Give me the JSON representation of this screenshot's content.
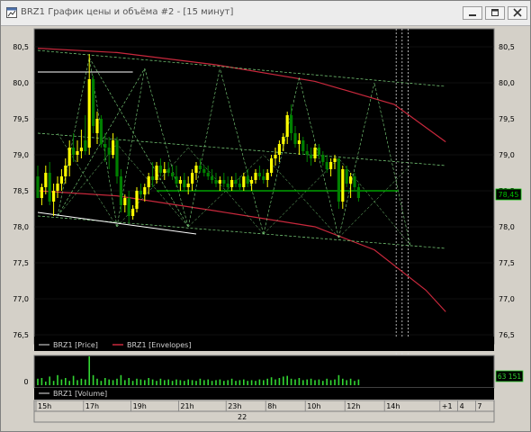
{
  "window": {
    "title": "BRZ1 График цены и объёма #2 - [15 минут]",
    "title_icon": "chart-window-icon",
    "buttons": [
      "minimize-icon",
      "maximize-icon",
      "close-icon"
    ]
  },
  "colors": {
    "background": "#000000",
    "frame": "#d4d0c8",
    "bull_candle": "#ffff00",
    "bear_candle": "#008000",
    "envelope": "#c8283c",
    "channel_lines": "#7fd87f",
    "support_line": "#00c000",
    "annotation_lines": "#ffffff",
    "volume_bars": "#33d633",
    "text": "#000000"
  },
  "chart_data": [
    {
      "type": "line",
      "name": "price",
      "chart_type": "candlestick",
      "ylim": [
        76.5,
        80.6
      ],
      "y_ticks": [
        "80,5",
        "80,0",
        "79,5",
        "79,0",
        "78,5",
        "78,0",
        "77,5",
        "77,0",
        "76,5"
      ],
      "last_price_label": "78,45",
      "legend": [
        "BRZ1 [Price]",
        "BRZ1 [Envelopes]"
      ],
      "candles": [
        [
          78.7,
          78.85,
          78.4,
          78.4
        ],
        [
          78.4,
          78.6,
          78.3,
          78.55
        ],
        [
          78.55,
          78.85,
          78.45,
          78.75
        ],
        [
          78.75,
          78.9,
          78.3,
          78.35
        ],
        [
          78.35,
          78.6,
          78.15,
          78.5
        ],
        [
          78.5,
          78.7,
          78.4,
          78.6
        ],
        [
          78.6,
          78.8,
          78.5,
          78.7
        ],
        [
          78.7,
          78.95,
          78.6,
          78.85
        ],
        [
          78.85,
          79.2,
          78.7,
          79.1
        ],
        [
          79.1,
          79.3,
          78.9,
          79.0
        ],
        [
          79.0,
          79.2,
          78.9,
          79.05
        ],
        [
          79.05,
          79.35,
          78.95,
          79.1
        ],
        [
          79.2,
          79.55,
          79.0,
          79.05
        ],
        [
          79.1,
          80.4,
          79.0,
          80.05
        ],
        [
          80.05,
          80.1,
          79.3,
          79.4
        ],
        [
          79.3,
          79.6,
          79.15,
          79.5
        ],
        [
          79.5,
          79.55,
          79.1,
          79.15
        ],
        [
          79.15,
          79.3,
          78.9,
          79.1
        ],
        [
          79.1,
          79.25,
          78.8,
          79.0
        ],
        [
          79.0,
          79.3,
          78.95,
          79.2
        ],
        [
          79.2,
          79.25,
          78.6,
          78.7
        ],
        [
          78.7,
          78.8,
          78.2,
          78.3
        ],
        [
          78.3,
          78.45,
          78.2,
          78.4
        ],
        [
          78.4,
          78.5,
          78.05,
          78.15
        ],
        [
          78.15,
          78.3,
          78.1,
          78.25
        ],
        [
          78.25,
          78.55,
          78.2,
          78.5
        ],
        [
          78.5,
          78.6,
          78.4,
          78.45
        ],
        [
          78.45,
          78.6,
          78.35,
          78.55
        ],
        [
          78.55,
          78.75,
          78.45,
          78.7
        ],
        [
          78.7,
          78.9,
          78.55,
          78.65
        ],
        [
          78.65,
          78.9,
          78.6,
          78.85
        ],
        [
          78.85,
          78.95,
          78.7,
          78.75
        ],
        [
          78.75,
          78.9,
          78.65,
          78.8
        ],
        [
          78.8,
          78.9,
          78.7,
          78.75
        ],
        [
          78.75,
          78.85,
          78.65,
          78.7
        ],
        [
          78.7,
          78.85,
          78.55,
          78.6
        ],
        [
          78.6,
          78.7,
          78.5,
          78.65
        ],
        [
          78.65,
          78.75,
          78.5,
          78.55
        ],
        [
          78.55,
          78.7,
          78.45,
          78.6
        ],
        [
          78.6,
          78.8,
          78.5,
          78.75
        ],
        [
          78.75,
          78.9,
          78.65,
          78.85
        ],
        [
          78.85,
          78.95,
          78.75,
          78.8
        ],
        [
          78.8,
          78.85,
          78.7,
          78.75
        ],
        [
          78.75,
          78.85,
          78.65,
          78.7
        ],
        [
          78.7,
          78.8,
          78.6,
          78.65
        ],
        [
          78.65,
          78.75,
          78.55,
          78.6
        ],
        [
          78.6,
          78.7,
          78.5,
          78.65
        ],
        [
          78.65,
          78.75,
          78.55,
          78.6
        ],
        [
          78.6,
          78.7,
          78.5,
          78.55
        ],
        [
          78.55,
          78.7,
          78.5,
          78.65
        ],
        [
          78.65,
          78.75,
          78.55,
          78.6
        ],
        [
          78.6,
          78.7,
          78.5,
          78.55
        ],
        [
          78.55,
          78.75,
          78.5,
          78.7
        ],
        [
          78.7,
          78.8,
          78.55,
          78.6
        ],
        [
          78.6,
          78.7,
          78.5,
          78.65
        ],
        [
          78.65,
          78.8,
          78.6,
          78.75
        ],
        [
          78.75,
          78.85,
          78.65,
          78.7
        ],
        [
          78.7,
          78.8,
          78.6,
          78.65
        ],
        [
          78.65,
          78.8,
          78.55,
          78.75
        ],
        [
          78.75,
          79.0,
          78.7,
          78.95
        ],
        [
          78.95,
          79.1,
          78.85,
          79.0
        ],
        [
          79.0,
          79.2,
          78.9,
          79.15
        ],
        [
          79.15,
          79.3,
          79.05,
          79.25
        ],
        [
          79.25,
          79.6,
          79.15,
          79.55
        ],
        [
          79.55,
          79.7,
          79.2,
          79.3
        ],
        [
          79.3,
          79.4,
          79.1,
          79.15
        ],
        [
          79.15,
          79.3,
          79.0,
          79.2
        ],
        [
          79.2,
          79.25,
          79.0,
          79.05
        ],
        [
          79.05,
          79.15,
          78.9,
          79.0
        ],
        [
          79.0,
          79.1,
          78.85,
          78.95
        ],
        [
          78.95,
          79.15,
          78.9,
          79.1
        ],
        [
          79.1,
          79.15,
          78.95,
          79.0
        ],
        [
          79.0,
          79.05,
          78.85,
          78.9
        ],
        [
          78.9,
          79.0,
          78.75,
          78.8
        ],
        [
          78.8,
          78.95,
          78.7,
          78.9
        ],
        [
          78.9,
          79.0,
          78.8,
          78.95
        ],
        [
          78.95,
          78.9,
          78.25,
          78.35
        ],
        [
          78.35,
          78.85,
          78.25,
          78.8
        ],
        [
          78.8,
          78.85,
          78.55,
          78.6
        ],
        [
          78.6,
          78.75,
          78.4,
          78.7
        ],
        [
          78.7,
          78.75,
          78.5,
          78.55
        ],
        [
          78.55,
          78.6,
          78.35,
          78.4
        ]
      ],
      "envelope_upper": [
        [
          0,
          80.48
        ],
        [
          20,
          80.42
        ],
        [
          45,
          80.25
        ],
        [
          70,
          80.02
        ],
        [
          90,
          79.7
        ],
        [
          103,
          79.18
        ]
      ],
      "envelope_lower": [
        [
          0,
          78.5
        ],
        [
          20,
          78.43
        ],
        [
          45,
          78.22
        ],
        [
          70,
          78.0
        ],
        [
          85,
          77.68
        ],
        [
          98,
          77.12
        ],
        [
          103,
          76.82
        ]
      ],
      "support_level": 78.5,
      "channel_upper": [
        [
          0,
          80.45
        ],
        [
          103,
          79.95
        ]
      ],
      "channel_mid": [
        [
          0,
          79.3
        ],
        [
          103,
          78.85
        ]
      ],
      "channel_lower": [
        [
          0,
          78.15
        ],
        [
          103,
          77.7
        ]
      ],
      "zigzag_peaks": [
        [
          13,
          80.35
        ],
        [
          27,
          80.2
        ],
        [
          46,
          80.2
        ],
        [
          66,
          80.07
        ],
        [
          85,
          80.0
        ]
      ],
      "zigzag_troughs": [
        [
          5,
          78.15
        ],
        [
          20,
          78.0
        ],
        [
          38,
          78.0
        ],
        [
          57,
          77.9
        ],
        [
          76,
          77.85
        ],
        [
          94,
          77.75
        ]
      ],
      "zigzag_mid_peaks": [
        [
          5,
          79.3
        ],
        [
          20,
          79.15
        ],
        [
          38,
          79.1
        ],
        [
          57,
          79.0
        ],
        [
          76,
          78.95
        ],
        [
          94,
          78.85
        ]
      ],
      "annotation_lines": [
        [
          [
            0,
            80.15
          ],
          [
            24,
            80.15
          ]
        ],
        [
          [
            0,
            78.2
          ],
          [
            40,
            77.9
          ]
        ]
      ]
    },
    {
      "type": "bar",
      "name": "volume",
      "legend": [
        "BRZ1 [Volume]"
      ],
      "y_ticks": [
        "0"
      ],
      "last_value_label": "63 151",
      "values": [
        9,
        10,
        5,
        12,
        6,
        14,
        8,
        10,
        6,
        13,
        7,
        9,
        8,
        40,
        14,
        9,
        6,
        10,
        8,
        7,
        9,
        14,
        7,
        10,
        6,
        9,
        8,
        7,
        10,
        8,
        6,
        9,
        7,
        8,
        6,
        8,
        7,
        6,
        8,
        7,
        6,
        9,
        7,
        8,
        6,
        7,
        8,
        6,
        7,
        9,
        6,
        7,
        8,
        6,
        7,
        6,
        8,
        7,
        9,
        11,
        8,
        10,
        12,
        13,
        9,
        8,
        10,
        7,
        8,
        9,
        7,
        8,
        6,
        9,
        7,
        8,
        14,
        9,
        7,
        9,
        6,
        8
      ]
    }
  ],
  "x_axis": {
    "time_labels": [
      "15h",
      "17h",
      "19h",
      "21h",
      "23h",
      "8h",
      "10h",
      "12h",
      "14h",
      "+1",
      "4",
      "7"
    ],
    "date_label": "22"
  }
}
